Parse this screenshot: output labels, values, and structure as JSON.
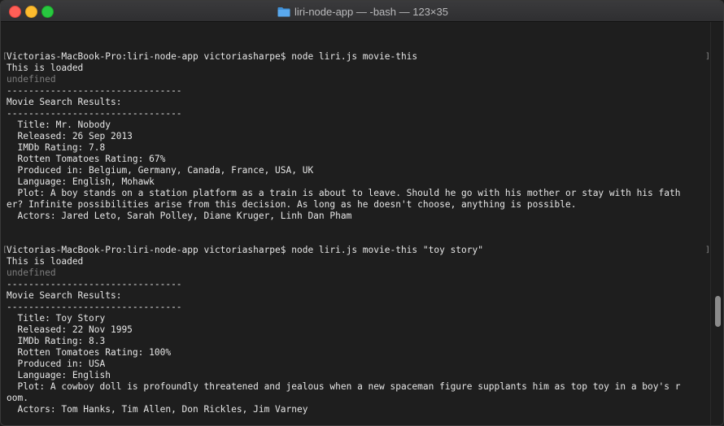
{
  "window": {
    "title": "liri-node-app — -bash — 123×35"
  },
  "icons": {
    "folder": "folder-icon",
    "close": "close-window-icon",
    "minimize": "minimize-window-icon",
    "maximize": "maximize-window-icon"
  },
  "colors": {
    "close": "#fe5f57",
    "minimize": "#febc2e",
    "maximize": "#28c840",
    "background": "#1e1e1e",
    "text": "#e6e6e6",
    "dim_text": "#7d7d7d",
    "folder": "#4aa0e6"
  },
  "terminal": {
    "lines": [
      "",
      "Victorias-MacBook-Pro:liri-node-app victoriasharpe$ node liri.js movie-this",
      "This is loaded",
      "undefined",
      "--------------------------------",
      "Movie Search Results:",
      "--------------------------------",
      "  Title: Mr. Nobody",
      "  Released: 26 Sep 2013",
      "  IMDb Rating: 7.8",
      "  Rotten Tomatoes Rating: 67%",
      "  Produced in: Belgium, Germany, Canada, France, USA, UK",
      "  Language: English, Mohawk",
      "  Plot: A boy stands on a station platform as a train is about to leave. Should he go with his mother or stay with his fath",
      "er? Infinite possibilities arise from this decision. As long as he doesn't choose, anything is possible.",
      "  Actors: Jared Leto, Sarah Polley, Diane Kruger, Linh Dan Pham",
      "",
      "",
      "Victorias-MacBook-Pro:liri-node-app victoriasharpe$ node liri.js movie-this \"toy story\"",
      "This is loaded",
      "undefined",
      "--------------------------------",
      "Movie Search Results:",
      "--------------------------------",
      "  Title: Toy Story",
      "  Released: 22 Nov 1995",
      "  IMDb Rating: 8.3",
      "  Rotten Tomatoes Rating: 100%",
      "  Produced in: USA",
      "  Language: English",
      "  Plot: A cowboy doll is profoundly threatened and jealous when a new spaceman figure supplants him as top toy in a boy's r",
      "oom.",
      "  Actors: Tom Hanks, Tim Allen, Don Rickles, Jim Varney"
    ],
    "dim_line_indices": [
      3,
      20
    ],
    "prompt_line_indices": [
      1,
      18
    ]
  },
  "scroll": {
    "position_fraction": 0.72
  }
}
